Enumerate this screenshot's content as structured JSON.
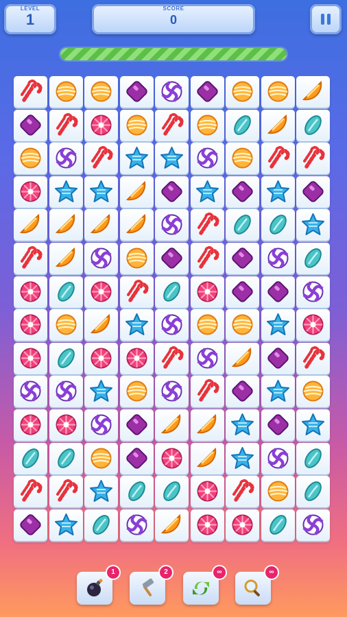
{
  "hud": {
    "level_label": "LEVEL",
    "level_value": "1",
    "score_label": "SCORE",
    "score_value": "0"
  },
  "timer": {
    "progress": 1.0
  },
  "board": {
    "rows": 14,
    "cols": 9,
    "grid": [
      [
        "cane",
        "orange",
        "orange",
        "gem",
        "swirl",
        "gem",
        "orange",
        "orange",
        "slice"
      ],
      [
        "gem",
        "cane",
        "pink",
        "orange",
        "cane",
        "orange",
        "teal",
        "slice",
        "teal"
      ],
      [
        "orange",
        "swirl",
        "cane",
        "star",
        "star",
        "swirl",
        "orange",
        "cane",
        "cane"
      ],
      [
        "pink",
        "star",
        "star",
        "slice",
        "gem",
        "star",
        "gem",
        "star",
        "gem"
      ],
      [
        "slice",
        "slice",
        "slice",
        "slice",
        "swirl",
        "cane",
        "teal",
        "teal",
        "star"
      ],
      [
        "cane",
        "slice",
        "swirl",
        "orange",
        "gem",
        "cane",
        "gem",
        "swirl",
        "teal"
      ],
      [
        "pink",
        "teal",
        "pink",
        "cane",
        "teal",
        "pink",
        "gem",
        "gem",
        "swirl"
      ],
      [
        "pink",
        "orange",
        "slice",
        "star",
        "swirl",
        "orange",
        "orange",
        "star",
        "pink"
      ],
      [
        "pink",
        "teal",
        "pink",
        "pink",
        "cane",
        "swirl",
        "slice",
        "gem",
        "cane"
      ],
      [
        "swirl",
        "swirl",
        "star",
        "orange",
        "swirl",
        "cane",
        "gem",
        "star",
        "orange"
      ],
      [
        "pink",
        "pink",
        "swirl",
        "gem",
        "slice",
        "slice",
        "star",
        "gem",
        "star"
      ],
      [
        "teal",
        "teal",
        "orange",
        "gem",
        "pink",
        "slice",
        "star",
        "swirl",
        "teal"
      ],
      [
        "cane",
        "cane",
        "star",
        "teal",
        "teal",
        "pink",
        "cane",
        "orange",
        "teal"
      ],
      [
        "gem",
        "star",
        "teal",
        "swirl",
        "slice",
        "pink",
        "pink",
        "teal",
        "swirl"
      ]
    ]
  },
  "boosters": [
    {
      "icon": "bomb-icon",
      "badge": "1"
    },
    {
      "icon": "hammer-icon",
      "badge": "2"
    },
    {
      "icon": "shuffle-icon",
      "badge": "∞"
    },
    {
      "icon": "magnifier-icon",
      "badge": "∞"
    }
  ]
}
